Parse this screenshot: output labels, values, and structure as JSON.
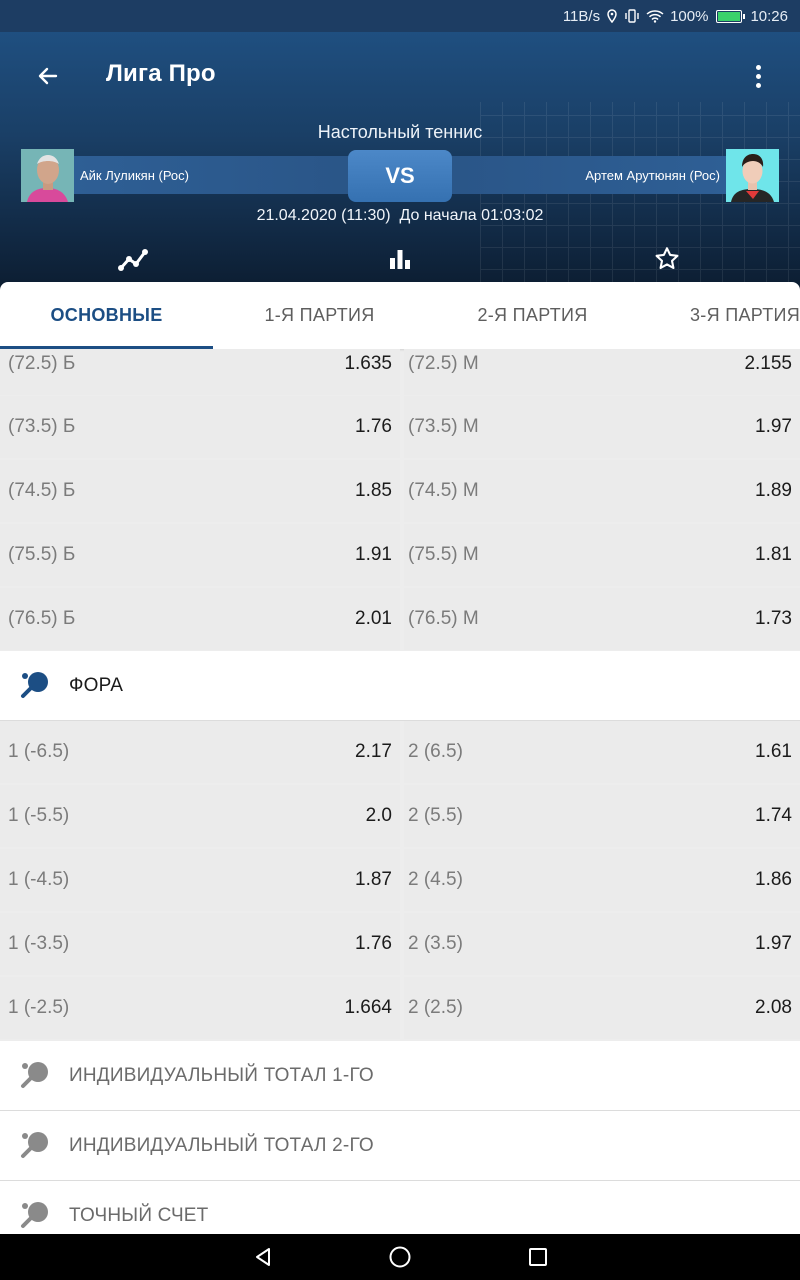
{
  "status_bar": {
    "speed": "11B/s",
    "battery": "100%",
    "time": "10:26"
  },
  "header": {
    "title": "Лига Про",
    "sport": "Настольный теннис"
  },
  "match": {
    "player1": "Айк Луликян (Рос)",
    "player2": "Артем Арутюнян (Рос)",
    "vs": "VS",
    "datetime": "21.04.2020 (11:30)",
    "countdown": "До начала 01:03:02"
  },
  "tabs": [
    "ОСНОВНЫЕ",
    "1-Я ПАРТИЯ",
    "2-Я ПАРТИЯ",
    "3-Я ПАРТИЯ"
  ],
  "active_tab": 0,
  "totals_rows": [
    {
      "left_label": "(72.5) Б",
      "left_odd": "1.635",
      "right_label": "(72.5) М",
      "right_odd": "2.155"
    },
    {
      "left_label": "(73.5) Б",
      "left_odd": "1.76",
      "right_label": "(73.5) М",
      "right_odd": "1.97"
    },
    {
      "left_label": "(74.5) Б",
      "left_odd": "1.85",
      "right_label": "(74.5) М",
      "right_odd": "1.89"
    },
    {
      "left_label": "(75.5) Б",
      "left_odd": "1.91",
      "right_label": "(75.5) М",
      "right_odd": "1.81"
    },
    {
      "left_label": "(76.5) Б",
      "left_odd": "2.01",
      "right_label": "(76.5) М",
      "right_odd": "1.73"
    }
  ],
  "fora_section": {
    "title": "ФОРА"
  },
  "fora_rows": [
    {
      "left_label": "1 (-6.5)",
      "left_odd": "2.17",
      "right_label": "2 (6.5)",
      "right_odd": "1.61"
    },
    {
      "left_label": "1 (-5.5)",
      "left_odd": "2.0",
      "right_label": "2 (5.5)",
      "right_odd": "1.74"
    },
    {
      "left_label": "1 (-4.5)",
      "left_odd": "1.87",
      "right_label": "2 (4.5)",
      "right_odd": "1.86"
    },
    {
      "left_label": "1 (-3.5)",
      "left_odd": "1.76",
      "right_label": "2 (3.5)",
      "right_odd": "1.97"
    },
    {
      "left_label": "1 (-2.5)",
      "left_odd": "1.664",
      "right_label": "2 (2.5)",
      "right_odd": "2.08"
    }
  ],
  "collapsed_sections": [
    {
      "title": "ИНДИВИДУАЛЬНЫЙ ТОТАЛ 1-ГО"
    },
    {
      "title": "ИНДИВИДУАЛЬНЫЙ ТОТАЛ 2-ГО"
    },
    {
      "title": "ТОЧНЫЙ СЧЕТ"
    }
  ],
  "colors": {
    "accent": "#1c4e84",
    "header_top": "#1f4f80",
    "header_bottom": "#0c1d31",
    "vs": "#3f7cbd",
    "section_icon_active": "#1c4e84",
    "section_icon_inactive": "#8a8a8a"
  },
  "icons": {
    "back": "arrow-left-icon",
    "menu": "more-vertical-icon",
    "chart": "line-chart-icon",
    "stats": "bar-chart-icon",
    "favorite": "star-icon",
    "section": "ping-pong-paddle-icon"
  }
}
